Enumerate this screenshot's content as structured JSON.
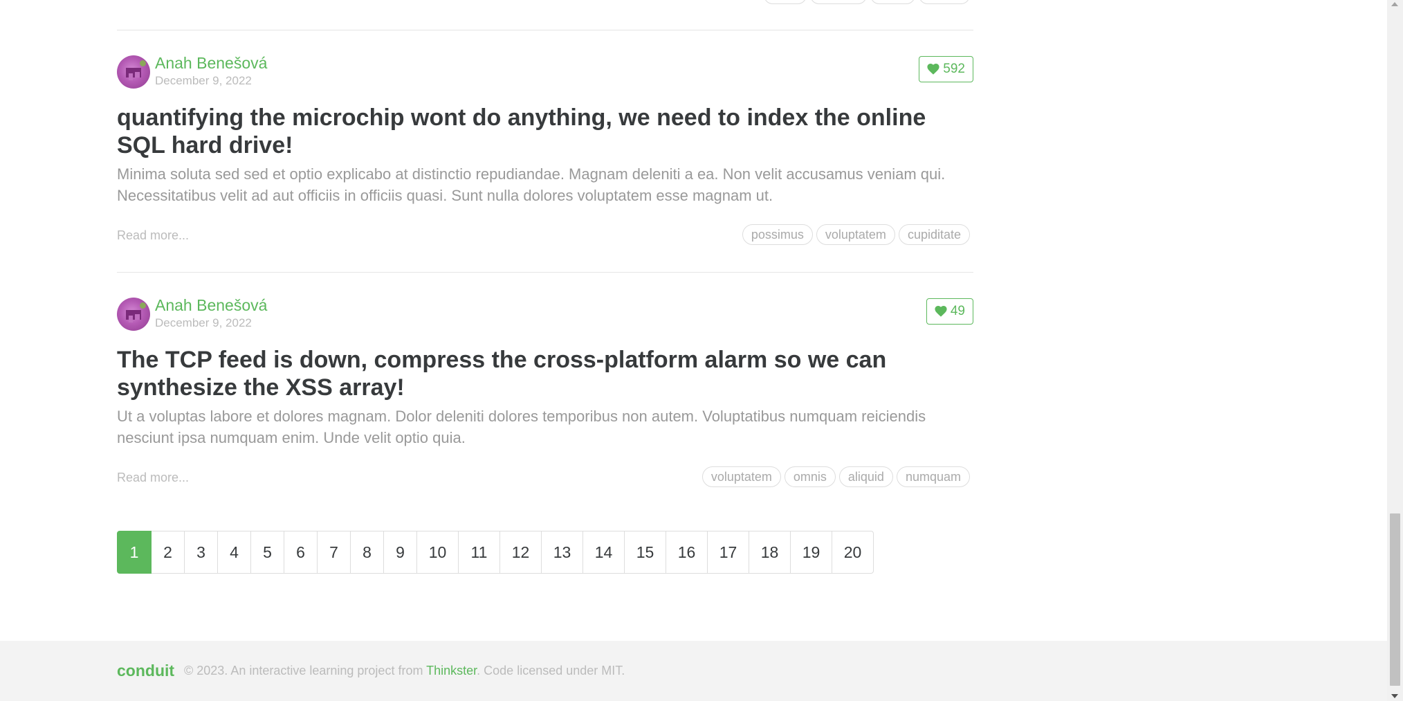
{
  "articles": [
    {
      "author": "Anah Benešová",
      "date": "December 9, 2022",
      "likes": "592",
      "title": "quantifying the microchip wont do anything, we need to index the online SQL hard drive!",
      "description": "Minima soluta sed sed et optio explicabo at distinctio repudiandae. Magnam deleniti a ea. Non velit accusamus veniam qui. Necessitatibus velit ad aut officiis in officiis quasi. Sunt nulla dolores voluptatem esse magnam ut.",
      "read_more": "Read more...",
      "tags": [
        "possimus",
        "voluptatem",
        "cupiditate"
      ]
    },
    {
      "author": "Anah Benešová",
      "date": "December 9, 2022",
      "likes": "49",
      "title": "The TCP feed is down, compress the cross-platform alarm so we can synthesize the XSS array!",
      "description": "Ut a voluptas labore et dolores magnam. Dolor deleniti dolores temporibus non autem. Voluptatibus numquam reiciendis nesciunt ipsa numquam enim. Unde velit optio quia.",
      "read_more": "Read more...",
      "tags": [
        "voluptatem",
        "omnis",
        "aliquid",
        "numquam"
      ]
    }
  ],
  "pagination": {
    "active": "1",
    "pages": [
      "1",
      "2",
      "3",
      "4",
      "5",
      "6",
      "7",
      "8",
      "9",
      "10",
      "11",
      "12",
      "13",
      "14",
      "15",
      "16",
      "17",
      "18",
      "19",
      "20"
    ]
  },
  "footer": {
    "logo": "conduit",
    "copyright_prefix": "© 2023. An interactive learning project from ",
    "link": "Thinkster",
    "copyright_suffix": ". Code licensed under MIT."
  },
  "colors": {
    "accent": "#5cb85c",
    "text_dark": "#373a3c",
    "text_muted": "#999999"
  },
  "icons": {
    "like": "heart-icon",
    "avatar": "avatar"
  }
}
